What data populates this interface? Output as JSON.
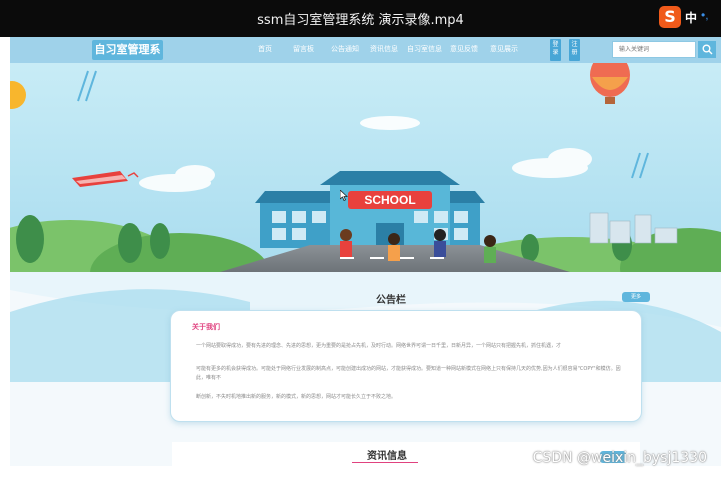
{
  "video": {
    "title": "ssm自习室管理系统 演示录像.mp4"
  },
  "ime": {
    "logo": "S",
    "label": "中",
    "dots": "•,"
  },
  "site": {
    "brand": "自习室管理系统",
    "nav": [
      "首页",
      "留言板",
      "公告通知",
      "资讯信息",
      "自习室信息",
      "意见反馈",
      "意见展示"
    ],
    "login": "登录",
    "register": "注册",
    "search_placeholder": "输入关键词"
  },
  "hero": {
    "sign": "SCHOOL"
  },
  "notice": {
    "title": "公告栏",
    "more": "更多",
    "about_title": "关于我们",
    "paragraphs": [
      "一个网站要取得成功，要有先进的理念、先进的思想，更为重要的是抢占先机，及时行动。网络世界可谓一日千里，日新月异，一个网站只有把握先机，抓住机遇，才",
      "可能有更多的机会获得成功。可能处于网络行业发展的制高点，可能创建出成功的网站，才能获得成功。要知道一种网站新模式在网络上只有保持几天的优势,因为人们很容易\"COPY\"和模仿。因此，唯有不",
      "断创新，不失时机地推出新的服务，新的模式，新的思想，网站才可能长久立于不败之地。"
    ]
  },
  "news": {
    "title": "资讯信息"
  },
  "watermark": "CSDN @weixin_bysj1330",
  "colors": {
    "nav": "#9fd2ea",
    "accent": "#5fb6dd",
    "pink": "#e0427f",
    "sky": "#bfe6f2"
  }
}
